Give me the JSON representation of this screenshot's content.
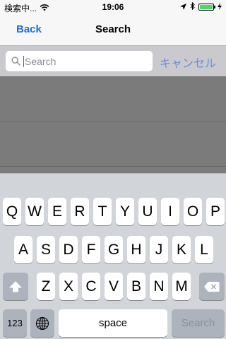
{
  "status_bar": {
    "carrier": "検索中...",
    "time": "19:06",
    "icons": [
      "wifi-icon",
      "location-arrow-icon",
      "bluetooth-icon",
      "battery-charging-icon"
    ],
    "battery_color": "#4cd964"
  },
  "nav": {
    "back_label": "Back",
    "title": "Search",
    "accent_color": "#1a6fd8"
  },
  "search": {
    "placeholder": "Search",
    "value": "",
    "cancel_label": "キャンセル"
  },
  "keyboard": {
    "row1": [
      "Q",
      "W",
      "E",
      "R",
      "T",
      "Y",
      "U",
      "I",
      "O",
      "P"
    ],
    "row2": [
      "A",
      "S",
      "D",
      "F",
      "G",
      "H",
      "J",
      "K",
      "L"
    ],
    "row3": [
      "Z",
      "X",
      "C",
      "V",
      "B",
      "N",
      "M"
    ],
    "numbers_label": "123",
    "space_label": "space",
    "search_label": "Search"
  }
}
